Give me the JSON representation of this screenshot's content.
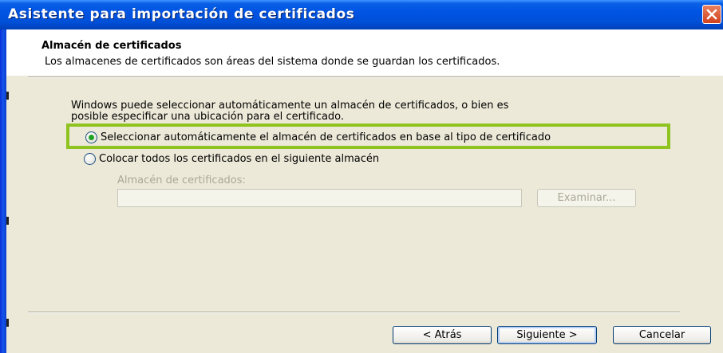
{
  "window": {
    "title": "Asistente para importación de certificados"
  },
  "header": {
    "title": "Almacén de certificados",
    "description": "Los almacenes de certificados son áreas del sistema donde se guardan los certificados."
  },
  "body": {
    "intro_line1": "Windows puede seleccionar automáticamente un almacén de certificados, o bien es",
    "intro_line2": "posible especificar una ubicación para el certificado.",
    "option_auto": "Seleccionar automáticamente el almacén de certificados en base al tipo de certificado",
    "option_manual": "Colocar todos los certificados en el siguiente almacén",
    "selected_option": "auto",
    "store_label": "Almacén de certificados:",
    "store_value": "",
    "browse_button": "Examinar..."
  },
  "footer": {
    "back_button": "< Atrás",
    "next_button": "Siguiente >",
    "cancel_button": "Cancelar"
  },
  "colors": {
    "highlight": "#8fc31f",
    "titlebar": "#0054e3",
    "radio_dot": "#21a121"
  }
}
